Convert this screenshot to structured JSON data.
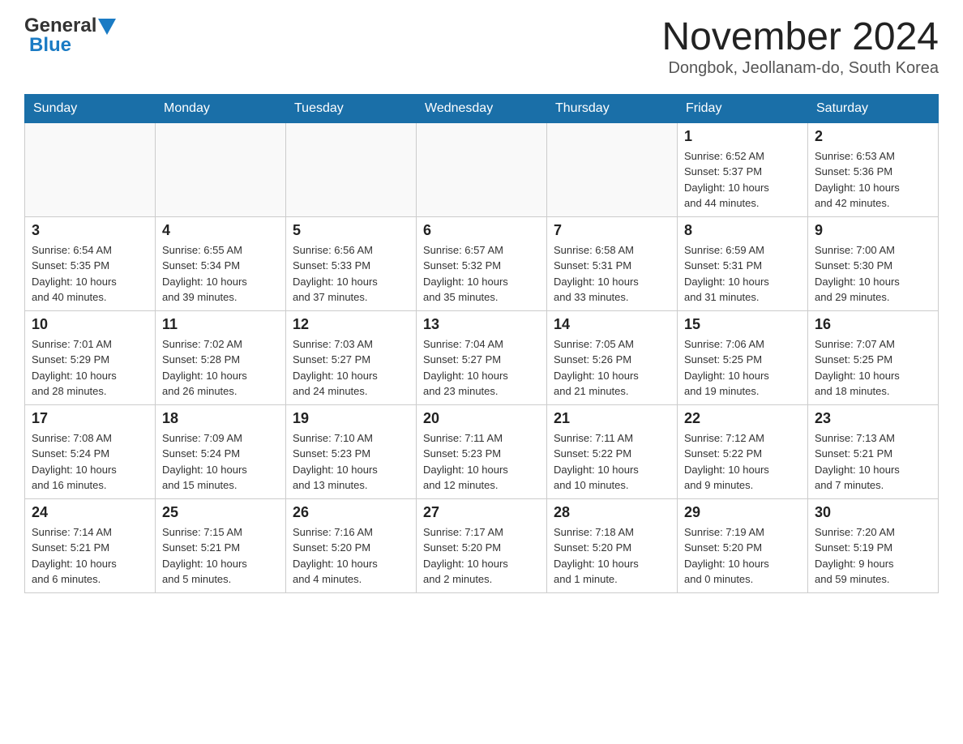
{
  "header": {
    "logo_general": "General",
    "logo_blue": "Blue",
    "month_title": "November 2024",
    "location": "Dongbok, Jeollanam-do, South Korea"
  },
  "weekdays": [
    "Sunday",
    "Monday",
    "Tuesday",
    "Wednesday",
    "Thursday",
    "Friday",
    "Saturday"
  ],
  "weeks": [
    [
      {
        "day": "",
        "info": ""
      },
      {
        "day": "",
        "info": ""
      },
      {
        "day": "",
        "info": ""
      },
      {
        "day": "",
        "info": ""
      },
      {
        "day": "",
        "info": ""
      },
      {
        "day": "1",
        "info": "Sunrise: 6:52 AM\nSunset: 5:37 PM\nDaylight: 10 hours\nand 44 minutes."
      },
      {
        "day": "2",
        "info": "Sunrise: 6:53 AM\nSunset: 5:36 PM\nDaylight: 10 hours\nand 42 minutes."
      }
    ],
    [
      {
        "day": "3",
        "info": "Sunrise: 6:54 AM\nSunset: 5:35 PM\nDaylight: 10 hours\nand 40 minutes."
      },
      {
        "day": "4",
        "info": "Sunrise: 6:55 AM\nSunset: 5:34 PM\nDaylight: 10 hours\nand 39 minutes."
      },
      {
        "day": "5",
        "info": "Sunrise: 6:56 AM\nSunset: 5:33 PM\nDaylight: 10 hours\nand 37 minutes."
      },
      {
        "day": "6",
        "info": "Sunrise: 6:57 AM\nSunset: 5:32 PM\nDaylight: 10 hours\nand 35 minutes."
      },
      {
        "day": "7",
        "info": "Sunrise: 6:58 AM\nSunset: 5:31 PM\nDaylight: 10 hours\nand 33 minutes."
      },
      {
        "day": "8",
        "info": "Sunrise: 6:59 AM\nSunset: 5:31 PM\nDaylight: 10 hours\nand 31 minutes."
      },
      {
        "day": "9",
        "info": "Sunrise: 7:00 AM\nSunset: 5:30 PM\nDaylight: 10 hours\nand 29 minutes."
      }
    ],
    [
      {
        "day": "10",
        "info": "Sunrise: 7:01 AM\nSunset: 5:29 PM\nDaylight: 10 hours\nand 28 minutes."
      },
      {
        "day": "11",
        "info": "Sunrise: 7:02 AM\nSunset: 5:28 PM\nDaylight: 10 hours\nand 26 minutes."
      },
      {
        "day": "12",
        "info": "Sunrise: 7:03 AM\nSunset: 5:27 PM\nDaylight: 10 hours\nand 24 minutes."
      },
      {
        "day": "13",
        "info": "Sunrise: 7:04 AM\nSunset: 5:27 PM\nDaylight: 10 hours\nand 23 minutes."
      },
      {
        "day": "14",
        "info": "Sunrise: 7:05 AM\nSunset: 5:26 PM\nDaylight: 10 hours\nand 21 minutes."
      },
      {
        "day": "15",
        "info": "Sunrise: 7:06 AM\nSunset: 5:25 PM\nDaylight: 10 hours\nand 19 minutes."
      },
      {
        "day": "16",
        "info": "Sunrise: 7:07 AM\nSunset: 5:25 PM\nDaylight: 10 hours\nand 18 minutes."
      }
    ],
    [
      {
        "day": "17",
        "info": "Sunrise: 7:08 AM\nSunset: 5:24 PM\nDaylight: 10 hours\nand 16 minutes."
      },
      {
        "day": "18",
        "info": "Sunrise: 7:09 AM\nSunset: 5:24 PM\nDaylight: 10 hours\nand 15 minutes."
      },
      {
        "day": "19",
        "info": "Sunrise: 7:10 AM\nSunset: 5:23 PM\nDaylight: 10 hours\nand 13 minutes."
      },
      {
        "day": "20",
        "info": "Sunrise: 7:11 AM\nSunset: 5:23 PM\nDaylight: 10 hours\nand 12 minutes."
      },
      {
        "day": "21",
        "info": "Sunrise: 7:11 AM\nSunset: 5:22 PM\nDaylight: 10 hours\nand 10 minutes."
      },
      {
        "day": "22",
        "info": "Sunrise: 7:12 AM\nSunset: 5:22 PM\nDaylight: 10 hours\nand 9 minutes."
      },
      {
        "day": "23",
        "info": "Sunrise: 7:13 AM\nSunset: 5:21 PM\nDaylight: 10 hours\nand 7 minutes."
      }
    ],
    [
      {
        "day": "24",
        "info": "Sunrise: 7:14 AM\nSunset: 5:21 PM\nDaylight: 10 hours\nand 6 minutes."
      },
      {
        "day": "25",
        "info": "Sunrise: 7:15 AM\nSunset: 5:21 PM\nDaylight: 10 hours\nand 5 minutes."
      },
      {
        "day": "26",
        "info": "Sunrise: 7:16 AM\nSunset: 5:20 PM\nDaylight: 10 hours\nand 4 minutes."
      },
      {
        "day": "27",
        "info": "Sunrise: 7:17 AM\nSunset: 5:20 PM\nDaylight: 10 hours\nand 2 minutes."
      },
      {
        "day": "28",
        "info": "Sunrise: 7:18 AM\nSunset: 5:20 PM\nDaylight: 10 hours\nand 1 minute."
      },
      {
        "day": "29",
        "info": "Sunrise: 7:19 AM\nSunset: 5:20 PM\nDaylight: 10 hours\nand 0 minutes."
      },
      {
        "day": "30",
        "info": "Sunrise: 7:20 AM\nSunset: 5:19 PM\nDaylight: 9 hours\nand 59 minutes."
      }
    ]
  ]
}
